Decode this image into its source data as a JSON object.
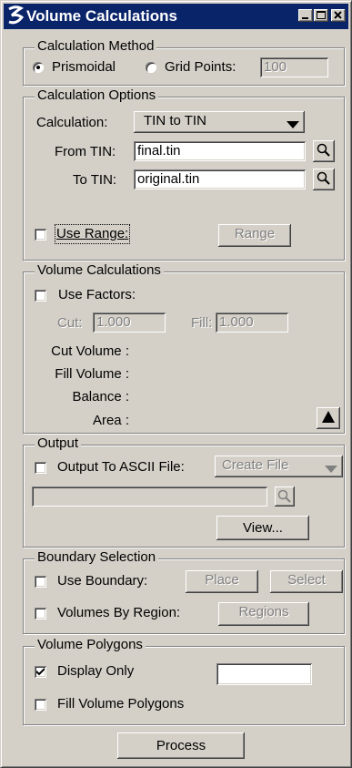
{
  "window": {
    "title": "Volume Calculations",
    "icon": "inroads-logo-icon",
    "controls": [
      "minimize-icon",
      "maximize-icon",
      "close-icon"
    ]
  },
  "calc_method": {
    "legend": "Calculation Method",
    "prismoidal": "Prismoidal",
    "prismoidal_selected": true,
    "grid_points": "Grid Points:",
    "grid_points_value": "100"
  },
  "calc_options": {
    "legend": "Calculation Options",
    "calculation_label": "Calculation:",
    "calculation_value": "TIN to TIN",
    "from_label": "From TIN:",
    "from_value": "final.tin",
    "to_label": "To TIN:",
    "to_value": "original.tin",
    "browse_icon": "magnifier-icon",
    "use_range": "Use Range:",
    "use_range_checked": false,
    "range_button": "Range"
  },
  "volume_calcs": {
    "legend": "Volume Calculations",
    "use_factors": "Use Factors:",
    "use_factors_checked": false,
    "cut_label": "Cut:",
    "cut_value": "1.000",
    "fill_label": "Fill:",
    "fill_value": "1.000",
    "cut_volume": "Cut Volume :",
    "fill_volume": "Fill Volume :",
    "balance": "Balance :",
    "area": "Area :",
    "expand_icon": "triangle-up-icon"
  },
  "output": {
    "legend": "Output",
    "to_ascii": "Output To ASCII File:",
    "to_ascii_checked": false,
    "mode_value": "Create File",
    "file_value": "",
    "view_button": "View..."
  },
  "boundary": {
    "legend": "Boundary Selection",
    "use_boundary": "Use Boundary:",
    "use_boundary_checked": false,
    "place_button": "Place",
    "select_button": "Select",
    "by_region": "Volumes By Region:",
    "by_region_checked": false,
    "regions_button": "Regions"
  },
  "polygons": {
    "legend": "Volume Polygons",
    "display_only": "Display Only",
    "display_only_checked": true,
    "color_swatch": "#ffffff",
    "fill_polygons": "Fill Volume Polygons",
    "fill_polygons_checked": false
  },
  "process_button": "Process"
}
